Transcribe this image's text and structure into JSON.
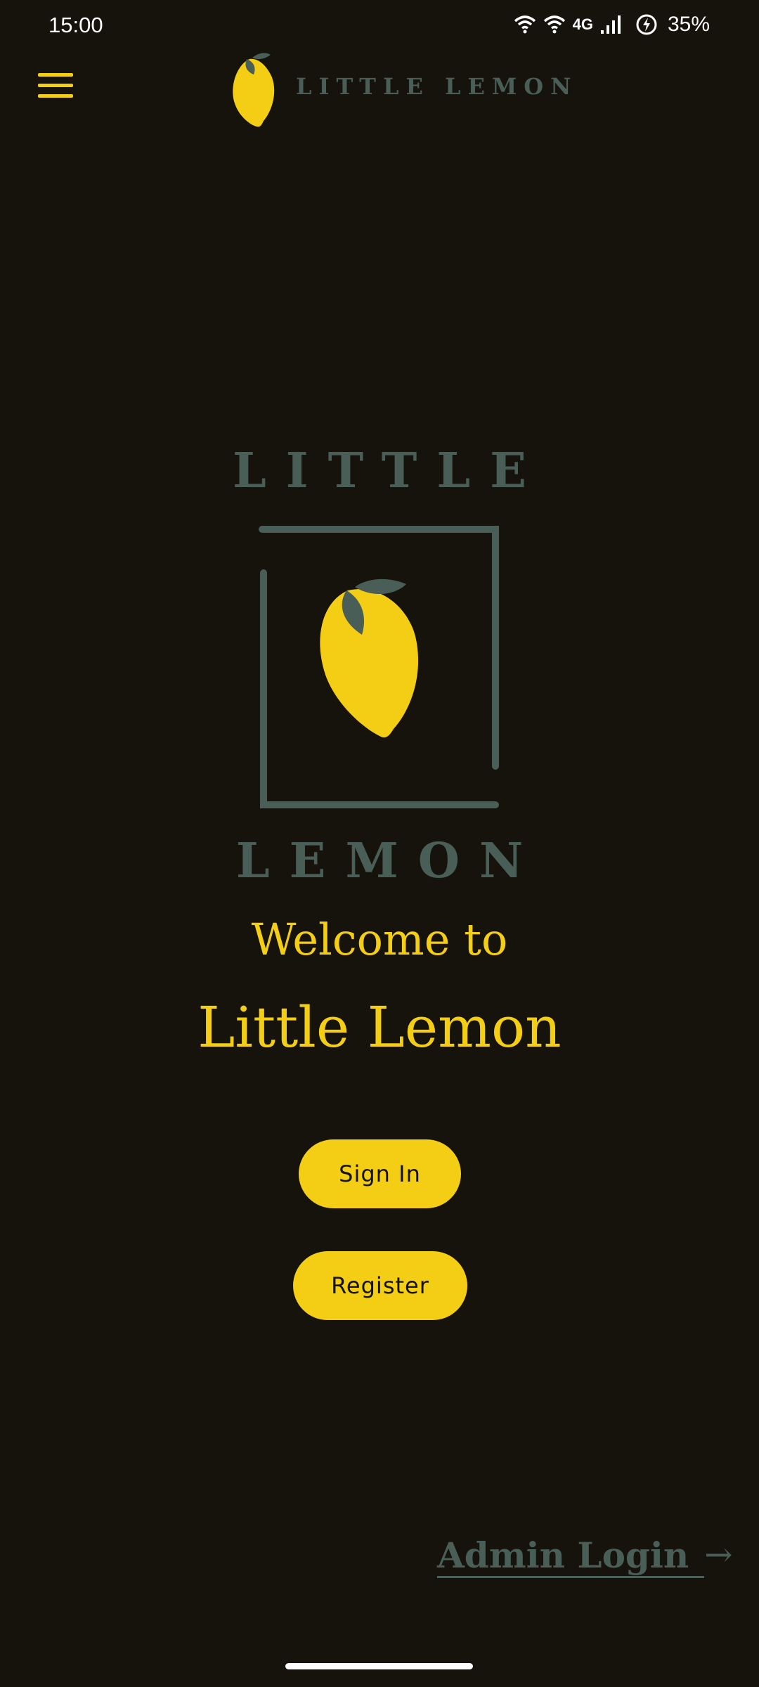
{
  "status_bar": {
    "time": "15:00",
    "network": "4G",
    "battery": "35%",
    "icons": [
      "wifi-icon",
      "wifi-icon",
      "signal-icon",
      "battery-saver-icon"
    ]
  },
  "header": {
    "menu_icon": "hamburger-menu-icon",
    "brand": "LITTLE LEMON"
  },
  "logo": {
    "top_word": "LITTLE",
    "bottom_word": "LEMON"
  },
  "welcome": {
    "line1": "Welcome to",
    "line2": "Little Lemon"
  },
  "buttons": {
    "sign_in": "Sign In",
    "register": "Register"
  },
  "admin": {
    "label": "Admin Login",
    "arrow": "→"
  },
  "colors": {
    "background": "#15130b",
    "accent": "#f4ce14",
    "muted_green": "#495e57"
  }
}
